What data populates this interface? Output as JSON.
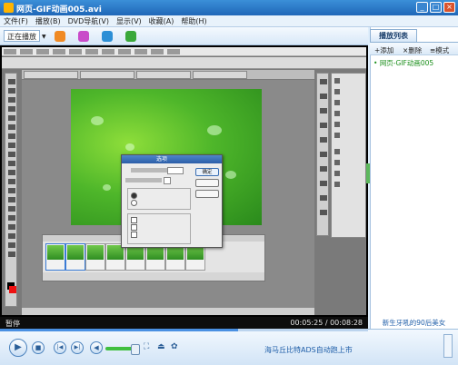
{
  "window": {
    "title": "网页-GIF动画005.avi"
  },
  "menu": [
    "文件(F)",
    "播放(B)",
    "DVD导航(V)",
    "显示(V)",
    "收藏(A)",
    "帮助(H)"
  ],
  "toolbar": {
    "now_playing": "正在播放"
  },
  "photoshop": {
    "ok_button": "确定",
    "dialog_title": "选项"
  },
  "status": {
    "state": "暂停",
    "time": "00:05:25 / 00:08:28"
  },
  "controls": {
    "ad_text": "海马丘比特ADS自动跑上市"
  },
  "playlist": {
    "tab": "播放列表",
    "add": "+添加",
    "delete": "×删除",
    "mode": "≡模式",
    "items": [
      "网页-GIF动画005"
    ],
    "footer": "新生牙吼的90后美女"
  },
  "colors": {
    "title_bar": "#1f67b8",
    "playlist_item": "#1b8f1b",
    "volume": "#3fbf3f"
  }
}
